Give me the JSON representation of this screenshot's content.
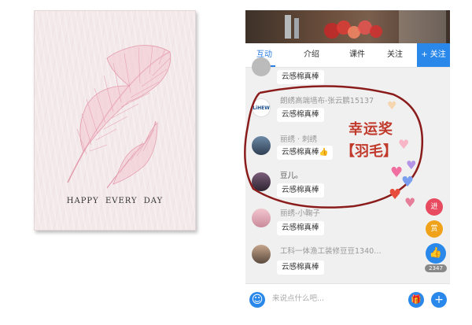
{
  "card": {
    "caption": "HAPPY EVERY DAY"
  },
  "tabs": [
    {
      "label": "互动",
      "active": true
    },
    {
      "label": "介绍",
      "active": false
    },
    {
      "label": "课件",
      "active": false
    },
    {
      "label": "关注",
      "active": false
    }
  ],
  "follow_button": "+ 关注",
  "messages": [
    {
      "user": "",
      "text": "云感棉真棒"
    },
    {
      "user": "朗绣高端墙布-张云鹏15137",
      "text": "云感棉真棒",
      "avatar_text": "LiHEW"
    },
    {
      "user": "丽绣 · 刺绣",
      "text": "云感棉真棒👍"
    },
    {
      "user": "豆儿。",
      "text": "云感棉真棒"
    },
    {
      "user": "丽绣-小鞠子",
      "text": "云感棉真棒"
    },
    {
      "user": "工科一体渔工装修豆豆1340…",
      "text": "云感棉真棒"
    }
  ],
  "annotation": {
    "line1": "幸运奖",
    "line2": "【羽毛】"
  },
  "side_badges": [
    "进",
    "赏"
  ],
  "like_count": "2347",
  "input": {
    "placeholder": "来说点什么吧..."
  },
  "colors": {
    "accent": "#2a88ea",
    "annotation_red": "#c0392b",
    "feather_pink": "#e9a5b4"
  }
}
